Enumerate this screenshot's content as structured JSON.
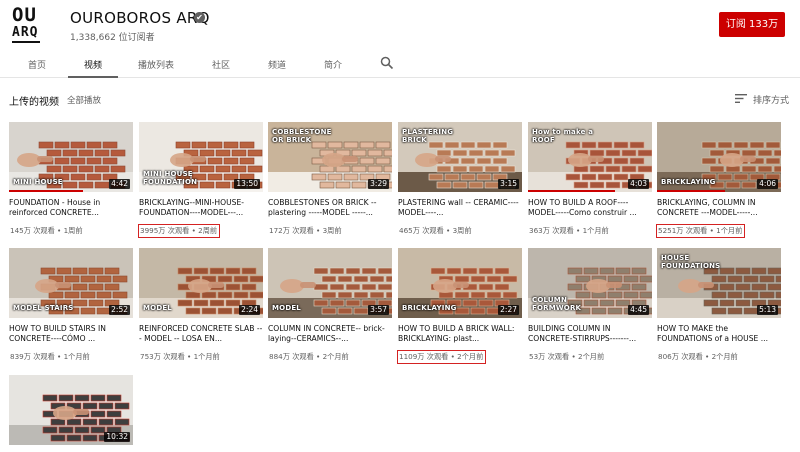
{
  "channel": {
    "logo_line1": "OU",
    "logo_line2": "ARQ",
    "name": "OUROBOROS ARQ",
    "verified_glyph": "✔",
    "subscribers": "1,338,662 位订阅者",
    "subscribe_label": "订阅  133万"
  },
  "tabs": [
    {
      "label": "首页"
    },
    {
      "label": "视频"
    },
    {
      "label": "播放列表"
    },
    {
      "label": "社区"
    },
    {
      "label": "频道"
    },
    {
      "label": "简介"
    }
  ],
  "section": {
    "title": "上传的视频",
    "play_all": "全部播放",
    "sort_label": "排序方式"
  },
  "colors": {
    "accent": "#cc0000",
    "highlight_box": "#d42222"
  },
  "videos": [
    {
      "title": "FOUNDATION - House in reinforced CONCRETE...",
      "meta": "145万 次观看 • 1周前",
      "duration": "4:42",
      "overlay": "MINI HOUSE",
      "progress": 0.6,
      "highlighted": false
    },
    {
      "title": "BRICKLAYING--MINI-HOUSE-FOUNDATION----MODEL---...",
      "meta": "3995万 次观看 • 2周前",
      "duration": "13:50",
      "overlay": "MINI HOUSE FOUNDATION",
      "progress": 0,
      "highlighted": true
    },
    {
      "title": "COBBLESTONES OR BRICK -- plastering -----MODEL -----...",
      "meta": "172万 次观看 • 3周前",
      "duration": "3:29",
      "overlay": "COBBLESTONE OR BRICK",
      "progress": 0,
      "highlighted": false
    },
    {
      "title": "PLASTERING wall -- CERAMIC----MODEL----...",
      "meta": "465万 次观看 • 3周前",
      "duration": "3:15",
      "overlay": "PLASTERING BRICK",
      "progress": 0,
      "highlighted": false
    },
    {
      "title": "HOW TO BUILD A ROOF----MODEL-----Como construir ...",
      "meta": "363万 次观看 • 1个月前",
      "duration": "4:03",
      "overlay": "How to make a ROOF",
      "progress": 0.7,
      "highlighted": false
    },
    {
      "title": "BRICKLAYING, COLUMN IN CONCRETE ---MODEL-----...",
      "meta": "5251万 次观看 • 1个月前",
      "duration": "4:06",
      "overlay": "BRICKLAYING",
      "progress": 0.55,
      "highlighted": true
    },
    {
      "title": "HOW TO BUILD STAIRS IN CONCRETE----CÓMO ...",
      "meta": "839万 次观看 • 1个月前",
      "duration": "2:52",
      "overlay": "MODEL STAIRS",
      "progress": 0,
      "highlighted": false
    },
    {
      "title": "REINFORCED CONCRETE SLAB --- MODEL -- LOSA EN...",
      "meta": "753万 次观看 • 1个月前",
      "duration": "2:24",
      "overlay": "MODEL",
      "progress": 0,
      "highlighted": false
    },
    {
      "title": "COLUMN IN CONCRETE-- brick-laying--CERAMICS--...",
      "meta": "884万 次观看 • 2个月前",
      "duration": "3:57",
      "overlay": "MODEL",
      "progress": 0,
      "highlighted": false
    },
    {
      "title": "HOW TO BUILD A BRICK WALL: BRICKLAYING: plast...",
      "meta": "1109万 次观看 • 2个月前",
      "duration": "2:27",
      "overlay": "BRICKLAYING",
      "progress": 0,
      "highlighted": true
    },
    {
      "title": "BUILDING COLUMN IN CONCRETE-STIRRUPS-------...",
      "meta": "53万 次观看 • 2个月前",
      "duration": "4:45",
      "overlay": "COLUMN FORMWORK",
      "progress": 0,
      "highlighted": false
    },
    {
      "title": "HOW TO MAKE the FOUNDATIONS of a HOUSE ...",
      "meta": "806万 次观看 • 2个月前",
      "duration": "5:13",
      "overlay": "HOUSE FOUNDATIONS",
      "progress": 0,
      "highlighted": false
    },
    {
      "title": "",
      "meta": "",
      "duration": "10:32",
      "overlay": "",
      "progress": 0,
      "highlighted": false
    }
  ]
}
